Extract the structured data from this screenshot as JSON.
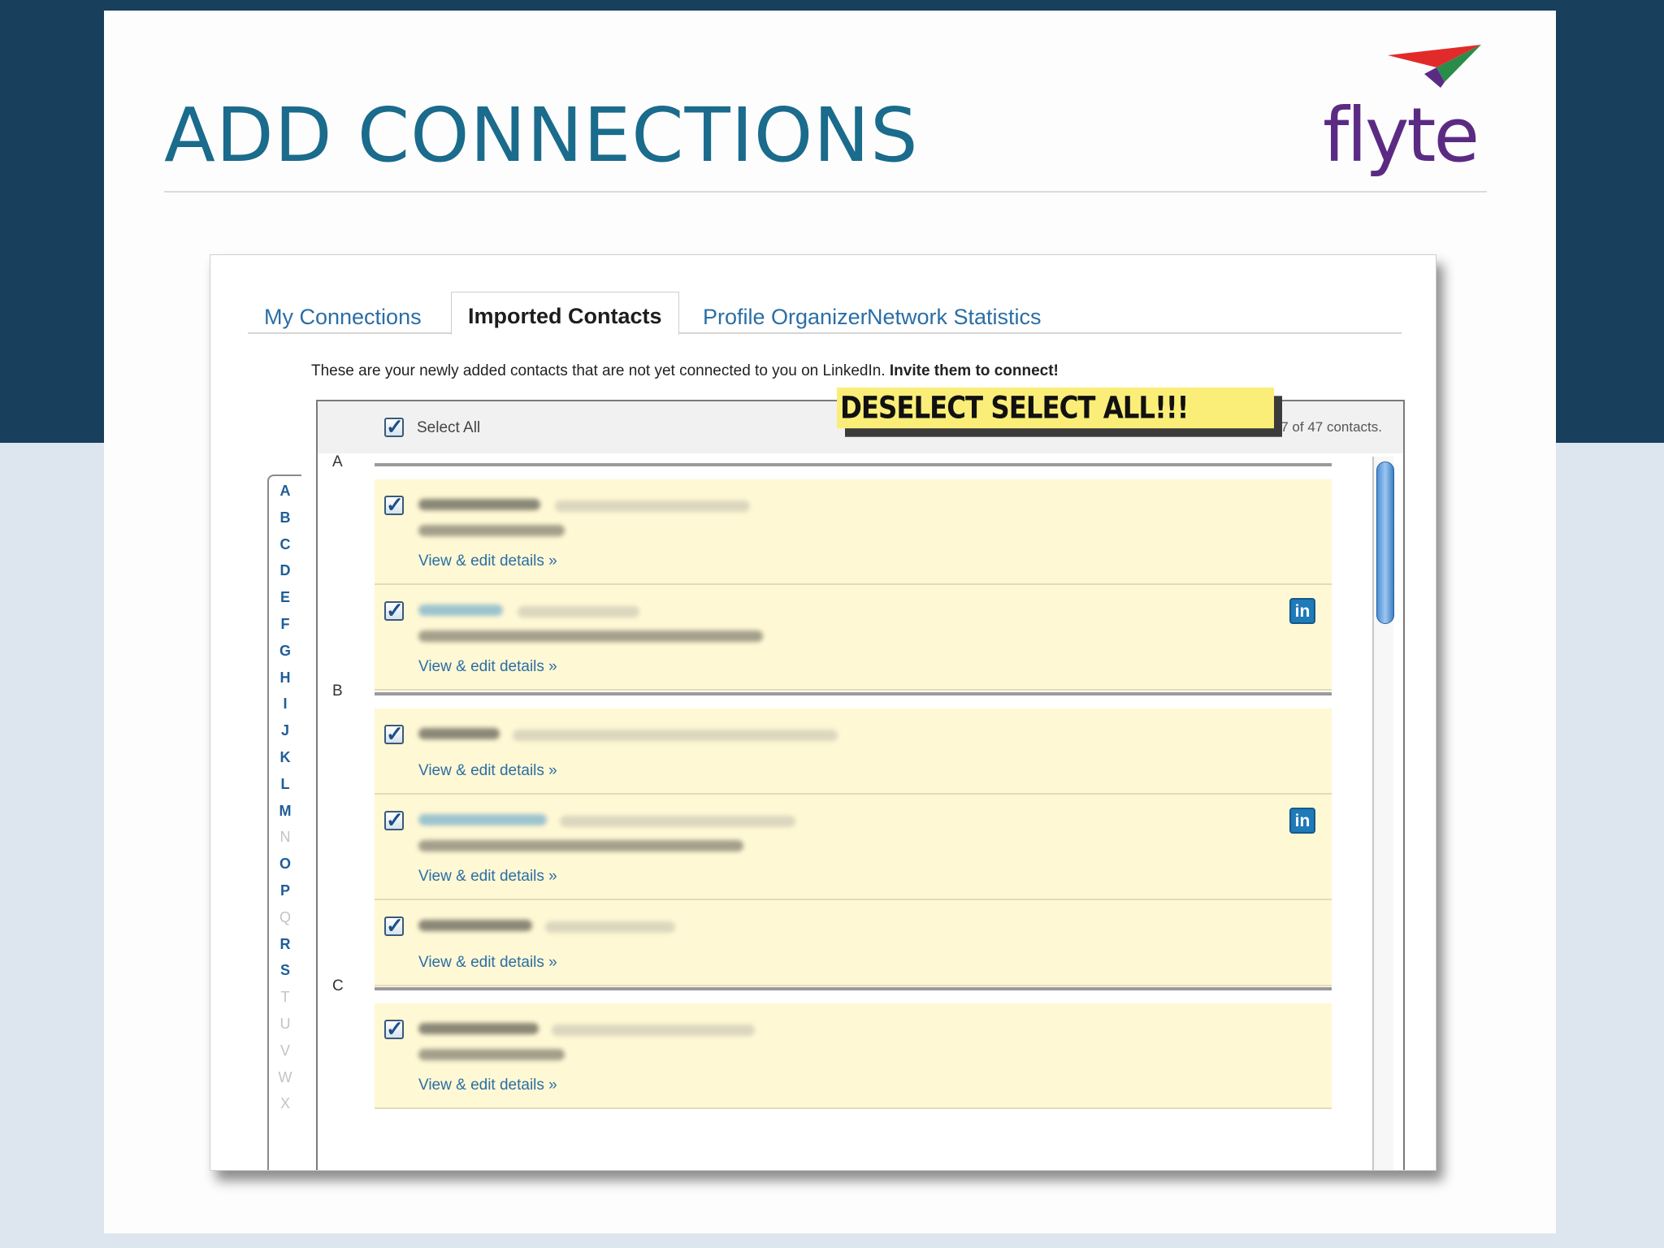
{
  "slide": {
    "title": "ADD CONNECTIONS",
    "logo_text": "flyte",
    "logo_colors": [
      "#e32a2a",
      "#2a8c4a",
      "#5b2b84"
    ]
  },
  "tabs": [
    {
      "label": "My Connections",
      "active": false
    },
    {
      "label": "Imported Contacts",
      "active": true
    },
    {
      "label": "Profile Organizer",
      "active": false
    },
    {
      "label": "Network Statistics",
      "active": false
    }
  ],
  "intro": {
    "text": "These are your newly added contacts that are not yet connected to you on LinkedIn.",
    "cta": "Invite them to connect!"
  },
  "list": {
    "select_all_label": "Select All",
    "showing_text": "Showing 47 of 47 contacts.",
    "annotation": "DESELECT SELECT ALL!!!"
  },
  "alphabet": [
    {
      "l": "A",
      "on": true
    },
    {
      "l": "B",
      "on": true
    },
    {
      "l": "C",
      "on": true
    },
    {
      "l": "D",
      "on": true
    },
    {
      "l": "E",
      "on": true
    },
    {
      "l": "F",
      "on": true
    },
    {
      "l": "G",
      "on": true
    },
    {
      "l": "H",
      "on": true
    },
    {
      "l": "I",
      "on": true
    },
    {
      "l": "J",
      "on": true
    },
    {
      "l": "K",
      "on": true
    },
    {
      "l": "L",
      "on": true
    },
    {
      "l": "M",
      "on": true
    },
    {
      "l": "N",
      "on": false
    },
    {
      "l": "O",
      "on": true
    },
    {
      "l": "P",
      "on": true
    },
    {
      "l": "Q",
      "on": false
    },
    {
      "l": "R",
      "on": true
    },
    {
      "l": "S",
      "on": true
    },
    {
      "l": "T",
      "on": false
    },
    {
      "l": "U",
      "on": false
    },
    {
      "l": "V",
      "on": false
    },
    {
      "l": "W",
      "on": false
    },
    {
      "l": "X",
      "on": false
    }
  ],
  "groups": [
    {
      "letter": "A",
      "contacts": [
        {
          "checked": true,
          "linkedin": false,
          "view_link": "View & edit details »"
        },
        {
          "checked": true,
          "linkedin": true,
          "view_link": "View & edit details »"
        }
      ]
    },
    {
      "letter": "B",
      "contacts": [
        {
          "checked": true,
          "linkedin": false,
          "view_link": "View & edit details »"
        },
        {
          "checked": true,
          "linkedin": true,
          "view_link": "View & edit details »"
        },
        {
          "checked": true,
          "linkedin": false,
          "view_link": "View & edit details »"
        }
      ]
    },
    {
      "letter": "C",
      "contacts": [
        {
          "checked": true,
          "linkedin": false,
          "view_link": "View & edit details »"
        }
      ]
    }
  ],
  "icons": {
    "checkbox": "checkmark-icon",
    "linkedin": "linkedin-icon"
  }
}
